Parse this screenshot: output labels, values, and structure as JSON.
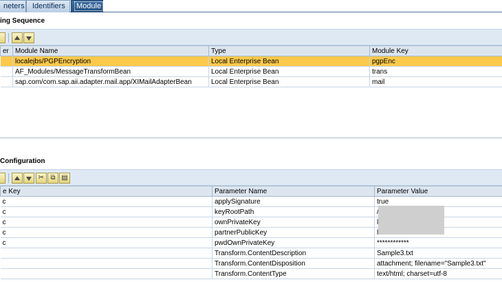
{
  "tabs": [
    {
      "label": "neters"
    },
    {
      "label": "Identifiers"
    },
    {
      "label": "Module",
      "active": true
    }
  ],
  "processing_sequence": {
    "title": "ing Sequence",
    "columns": [
      "er",
      "Module Name",
      "Type",
      "Module Key"
    ],
    "rows": [
      {
        "number": "",
        "module_name": "localejbs/PGPEncryption",
        "type": "Local Enterprise Bean",
        "module_key": "pgpEnc",
        "selected": true
      },
      {
        "number": "",
        "module_name": "AF_Modules/MessageTransformBean",
        "type": "Local Enterprise Bean",
        "module_key": "trans"
      },
      {
        "number": "",
        "module_name": "sap.com/com.sap.aii.adapter.mail.app/XIMailAdapterBean",
        "type": "Local Enterprise Bean",
        "module_key": "mail"
      }
    ]
  },
  "module_configuration": {
    "title": "Configuration",
    "columns": [
      "e Key",
      "Parameter Name",
      "Parameter Value"
    ],
    "rows": [
      {
        "key": "c",
        "name": "applySignature",
        "value": "true"
      },
      {
        "key": "c",
        "name": "keyRootPath",
        "value": "/"
      },
      {
        "key": "c",
        "name": "ownPrivateKey",
        "value": "l"
      },
      {
        "key": "c",
        "name": "partnerPublicKey",
        "value": "l"
      },
      {
        "key": "c",
        "name": "pwdOwnPrivateKey",
        "value": "************"
      },
      {
        "key": "",
        "name": "Transform.ContentDescription",
        "value": "Sample3.txt"
      },
      {
        "key": "",
        "name": "Transform.ContentDisposition",
        "value": "attachment; filename=\"Sample3.txt\""
      },
      {
        "key": "",
        "name": "Transform.ContentType",
        "value": "text/html; charset=utf-8"
      }
    ]
  },
  "icons": {
    "move_up": "arrow-up-icon",
    "move_down": "arrow-down-icon",
    "cut": "scissors-icon",
    "copy": "copy-icon",
    "paste": "paste-icon"
  },
  "colors": {
    "selected_row": "#fcc94b",
    "toolbar_bg": "#dfe9f3",
    "active_tab": "#24507f"
  }
}
